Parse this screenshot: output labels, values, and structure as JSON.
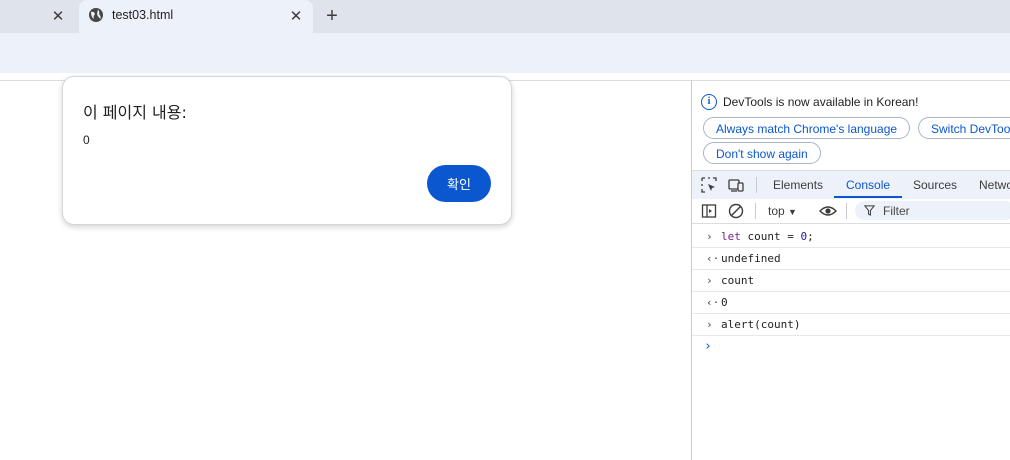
{
  "browser": {
    "tab_title": "test03.html",
    "new_tab_symbol": "+",
    "close_symbol": "✕"
  },
  "dialog": {
    "title": "이 페이지 내용:",
    "message": "0",
    "ok_label": "확인"
  },
  "devtools": {
    "info_icon": "i",
    "info_text": "DevTools is now available in Korean!",
    "buttons": {
      "match_language": "Always match Chrome's language",
      "switch_language": "Switch DevTools to Korean",
      "dont_show": "Don't show again"
    },
    "tabs": [
      {
        "label": "Elements"
      },
      {
        "label": "Console"
      },
      {
        "label": "Sources"
      },
      {
        "label": "Network"
      }
    ],
    "active_tab": "Console",
    "context": "top",
    "filter_placeholder": "Filter",
    "console_lines": [
      {
        "type": "input",
        "keyword": "let",
        "text": " count = ",
        "value": "0",
        "end": ";"
      },
      {
        "type": "output",
        "text": "undefined"
      },
      {
        "type": "input",
        "text": "count"
      },
      {
        "type": "output",
        "value": "0"
      },
      {
        "type": "input",
        "text": "alert(count)"
      }
    ]
  },
  "colors": {
    "accent": "#0b57d0",
    "tab_strip": "#dfe3eb",
    "toolbar": "#edf1f9"
  },
  "icons": [
    "globe-icon",
    "close-icon",
    "new-tab-icon",
    "info-icon",
    "inspect-element-icon",
    "device-toolbar-icon",
    "sidebar-toggle-icon",
    "clear-console-icon",
    "eye-icon",
    "filter-icon",
    "chevron-right-icon",
    "chevron-left-icon",
    "dropdown-arrow-icon"
  ]
}
